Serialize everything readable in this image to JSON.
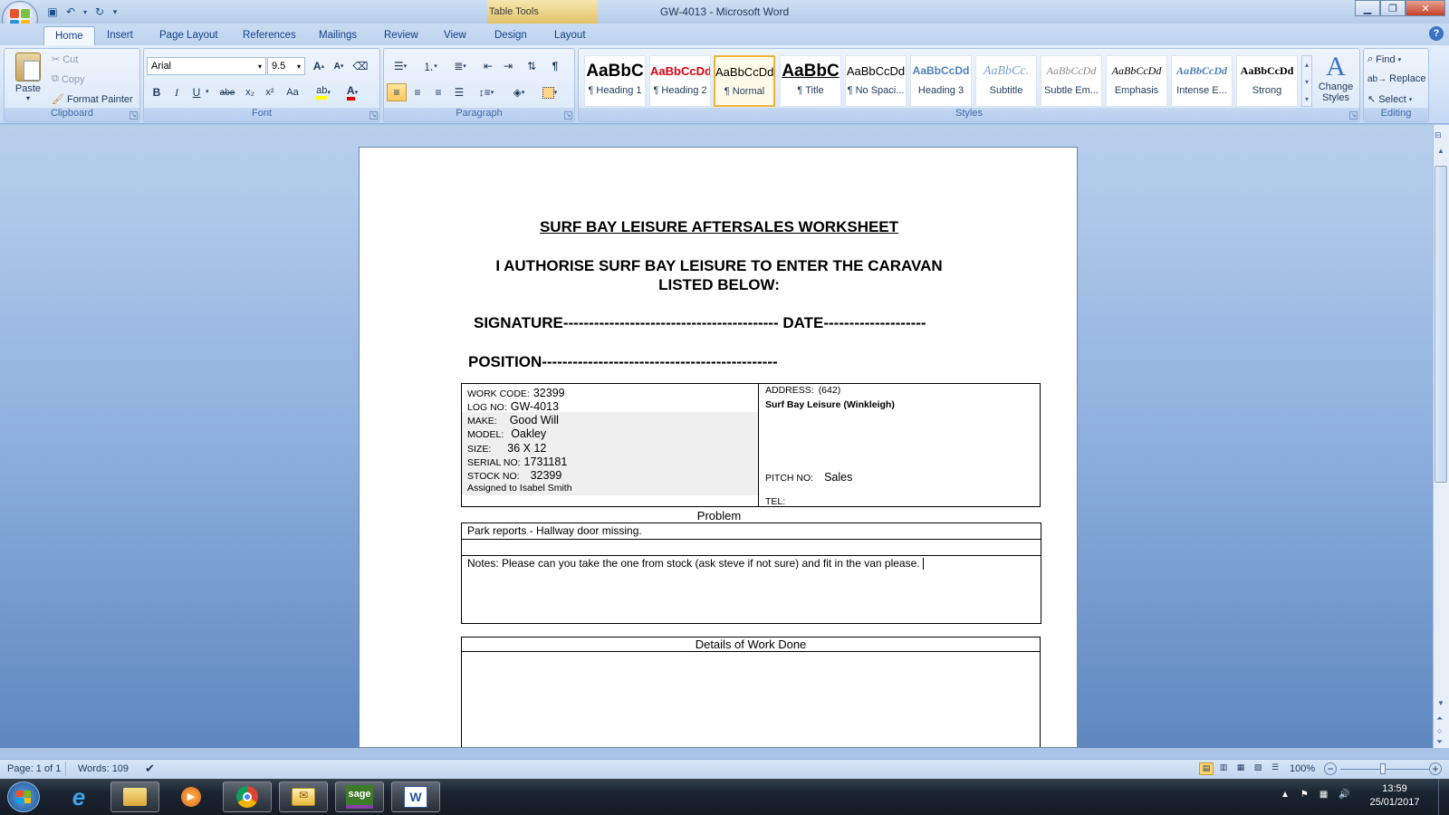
{
  "window": {
    "title": "GW-4013 - Microsoft Word",
    "table_tools": "Table Tools",
    "buttons": [
      "minimize",
      "maximize",
      "close"
    ]
  },
  "tabs": [
    "Home",
    "Insert",
    "Page Layout",
    "References",
    "Mailings",
    "Review",
    "View",
    "Design",
    "Layout"
  ],
  "active_tab": "Home",
  "ribbon": {
    "clipboard": {
      "label": "Clipboard",
      "paste": "Paste",
      "cut": "Cut",
      "copy": "Copy",
      "format_painter": "Format Painter"
    },
    "font": {
      "label": "Font",
      "font_name": "Arial",
      "font_size": "9.5",
      "bold": "B",
      "italic": "I",
      "underline": "U",
      "strike": "abe",
      "sub": "x₂",
      "sup": "x²",
      "case": "Aa"
    },
    "paragraph": {
      "label": "Paragraph"
    },
    "styles": {
      "label": "Styles",
      "items": [
        {
          "preview": "AaBbC",
          "name": "¶ Heading 1"
        },
        {
          "preview": "AaBbCcDd",
          "name": "¶ Heading 2"
        },
        {
          "preview": "AaBbCcDd",
          "name": "¶ Normal"
        },
        {
          "preview": "AaBbC",
          "name": "¶ Title"
        },
        {
          "preview": "AaBbCcDd",
          "name": "¶ No Spaci..."
        },
        {
          "preview": "AaBbCcDd",
          "name": "Heading 3"
        },
        {
          "preview": "AaBbCc.",
          "name": "Subtitle"
        },
        {
          "preview": "AaBbCcDd",
          "name": "Subtle Em..."
        },
        {
          "preview": "AaBbCcDd",
          "name": "Emphasis"
        },
        {
          "preview": "AaBbCcDd",
          "name": "Intense E..."
        },
        {
          "preview": "AaBbCcDd",
          "name": "Strong"
        }
      ],
      "change_styles": "Change Styles"
    },
    "editing": {
      "label": "Editing",
      "find": "Find",
      "replace": "Replace",
      "select": "Select"
    }
  },
  "document": {
    "heading": "SURF BAY LEISURE AFTERSALES WORKSHEET",
    "authorise_line1": "I AUTHORISE SURF BAY LEISURE TO ENTER THE CARAVAN",
    "authorise_line2": "LISTED BELOW:",
    "signature_line": "SIGNATURE------------------------------------------ DATE--------------------",
    "position_line": "POSITION----------------------------------------------",
    "fields": {
      "work_code_label": "WORK CODE:",
      "work_code": "32399",
      "log_no_label": "LOG NO:",
      "log_no": "GW-4013",
      "make_label": "MAKE:",
      "make": "Good Will",
      "model_label": "MODEL:",
      "model": "Oakley",
      "size_label": "SIZE:",
      "size": "36 X 12",
      "serial_label": "SERIAL NO:",
      "serial": "1731181",
      "stock_label": "STOCK NO:",
      "stock": "32399",
      "assigned": "Assigned to Isabel Smith",
      "address_label": "ADDRESS:",
      "address_code": "(642)",
      "address_name": "Surf Bay Leisure (Winkleigh)",
      "pitch_label": "PITCH NO:",
      "pitch": "Sales",
      "tel_label": "TEL:"
    },
    "problem_label": "Problem",
    "problem_text": "Park reports - Hallway door missing.",
    "notes_text": "Notes: Please can you take the one from stock (ask steve if not sure) and fit in the van please.",
    "details_label": "Details of Work Done"
  },
  "status": {
    "page": "Page: 1 of 1",
    "words": "Words: 109",
    "zoom": "100%"
  },
  "taskbar": {
    "time": "13:59",
    "date": "25/01/2017",
    "apps": [
      "start",
      "internet-explorer",
      "file-explorer",
      "media-player",
      "chrome",
      "outlook",
      "sage",
      "word"
    ]
  },
  "colors": {
    "ribbon_bg": "#dbe8f8",
    "accent": "#15428b",
    "selected_style_border": "#f0b23d",
    "heading2_red": "#e0000f"
  }
}
